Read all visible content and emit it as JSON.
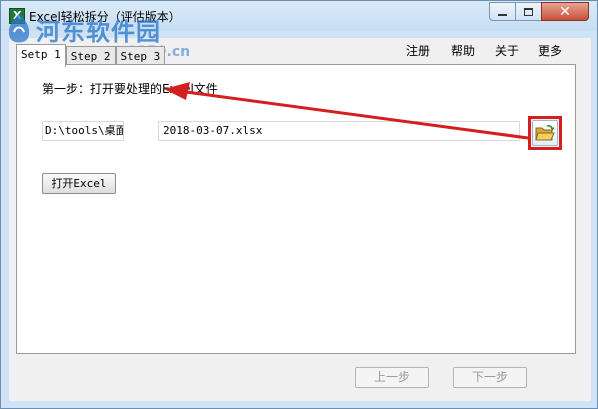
{
  "window": {
    "title": "Excel轻松拆分（评估版本）"
  },
  "watermark": {
    "text": "河东软件园",
    "url": "www.pc0359.cn"
  },
  "tabs": [
    {
      "label": "Setp 1",
      "active": true
    },
    {
      "label": "Step 2",
      "active": false
    },
    {
      "label": "Step 3",
      "active": false
    }
  ],
  "menu": {
    "register": "注册",
    "help": "帮助",
    "about": "关于",
    "more": "更多"
  },
  "step1": {
    "instruction": "第一步：打开要处理的Excel文件",
    "folder_path": "D:\\tools\\桌面",
    "file_name": "2018-03-07.xlsx",
    "open_excel_label": "打开Excel"
  },
  "nav": {
    "prev_label": "上一步",
    "next_label": "下一步"
  },
  "colors": {
    "annotation_red": "#d31f1f",
    "watermark_blue": "#2d78c8"
  }
}
